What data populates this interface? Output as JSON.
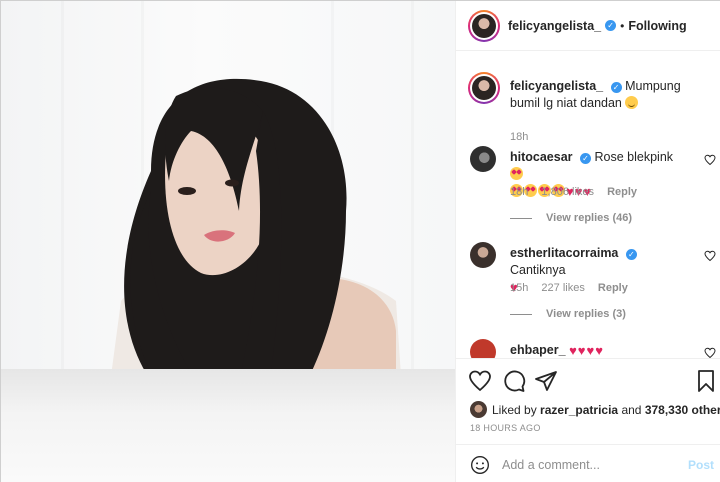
{
  "post": {
    "username": "felicyangelista_",
    "following_label": "Following",
    "dot": "•"
  },
  "caption": {
    "username": "felicyangelista_",
    "text": "Mumpung bumil lg niat dandan",
    "time": "18h"
  },
  "comments": [
    {
      "username": "hitocaesar",
      "text": "Rose blekpink",
      "time": "18h",
      "likes": "1,806 likes",
      "reply_label": "Reply",
      "view_replies": "View replies (46)"
    },
    {
      "username": "estherlitacorraima",
      "text": "Cantiknya",
      "time": "15h",
      "likes": "227 likes",
      "reply_label": "Reply",
      "view_replies": "View replies (3)"
    },
    {
      "username": "ehbaper_",
      "text": ""
    }
  ],
  "likes": {
    "prefix": "Liked by",
    "user": "razer_patricia",
    "mid": "and",
    "others": "378,330 others"
  },
  "posted": "18 HOURS AGO",
  "add_comment": {
    "placeholder": "Add a comment...",
    "post_label": "Post"
  },
  "colors": {
    "verified": "#3897f0",
    "heart": "#e0245e",
    "muted": "#8e8e8e",
    "post_disabled": "#b2dffc"
  },
  "icons": [
    "heart-icon",
    "comment-icon",
    "share-icon",
    "bookmark-icon",
    "smile-icon",
    "verified-icon"
  ]
}
